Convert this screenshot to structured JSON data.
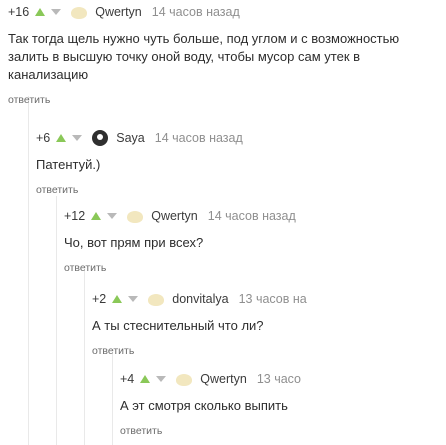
{
  "comments": [
    {
      "rating": "+16",
      "username": "Qwertyn",
      "time": "14 часов назад",
      "text": "Так тогда щель нужно чуть больше, под углом и с возможностью залить в высшую точку оной воду, чтобы мусор сам утек в канализацию",
      "reply": "ответить"
    },
    {
      "rating": "+6",
      "username": "Saya",
      "time": "14 часов назад",
      "text": "Патентуй.)",
      "reply": "ответить"
    },
    {
      "rating": "+12",
      "username": "Qwertyn",
      "time": "14 часов назад",
      "text": "Чо, вот прям при всех?",
      "reply": "ответить"
    },
    {
      "rating": "+2",
      "username": "donvitalya",
      "time": "13 часов на",
      "text": "А ты стеснительный что ли?",
      "reply": "ответить"
    },
    {
      "rating": "+4",
      "username": "Qwertyn",
      "time": "13 часо",
      "text": "А эт смотря сколько выпить",
      "reply": "ответить"
    }
  ],
  "colors": {
    "upvote": "#8ac858",
    "downvote": "#b9b9b9"
  },
  "icons": {
    "upvote": "triangle-up-icon",
    "downvote": "triangle-down-icon"
  }
}
